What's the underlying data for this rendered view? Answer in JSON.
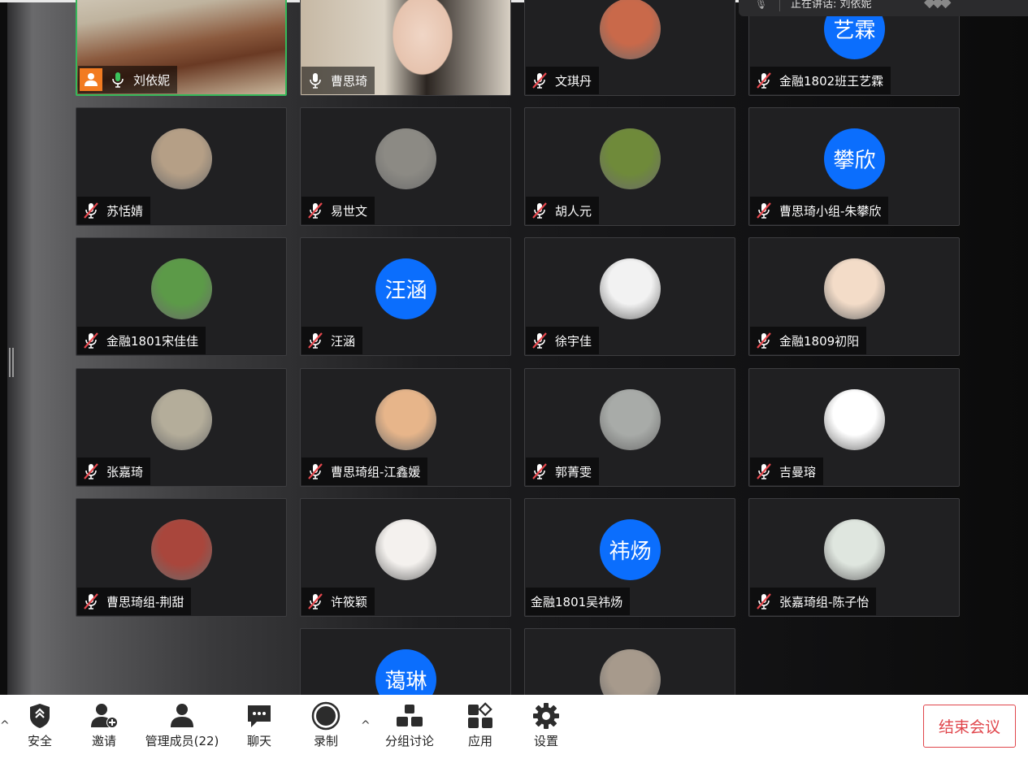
{
  "speaker_popup": {
    "text": "正在讲话: 刘依妮"
  },
  "participants": [
    {
      "name": "刘依妮",
      "mic": "on",
      "host": true,
      "type": "video-room"
    },
    {
      "name": "曹思琦",
      "mic": "on",
      "type": "video-face"
    },
    {
      "name": "文琪丹",
      "mic": "muted",
      "type": "photo",
      "photo_color": "#c9694a"
    },
    {
      "name": "金融1802班王艺霖",
      "mic": "muted",
      "type": "text",
      "avatar_text": "艺霖"
    },
    {
      "name": "苏恬婧",
      "mic": "muted",
      "type": "photo",
      "photo_color": "#b59f86"
    },
    {
      "name": "易世文",
      "mic": "muted",
      "type": "photo",
      "photo_color": "#8c8a84"
    },
    {
      "name": "胡人元",
      "mic": "muted",
      "type": "photo",
      "photo_color": "#6f8a3a"
    },
    {
      "name": "曹思琦小组-朱攀欣",
      "mic": "muted",
      "type": "text",
      "avatar_text": "攀欣"
    },
    {
      "name": "金融1801宋佳佳",
      "mic": "muted",
      "type": "photo",
      "photo_color": "#5c9a48"
    },
    {
      "name": "汪涵",
      "mic": "muted",
      "type": "text",
      "avatar_text": "汪涵"
    },
    {
      "name": "徐宇佳",
      "mic": "muted",
      "type": "photo",
      "photo_color": "#f2f2f2"
    },
    {
      "name": "金融1809初阳",
      "mic": "muted",
      "type": "photo",
      "photo_color": "#f3dcc8"
    },
    {
      "name": "张嘉琦",
      "mic": "muted",
      "type": "photo",
      "photo_color": "#b4ad9a"
    },
    {
      "name": "曹思琦组-江鑫媛",
      "mic": "muted",
      "type": "photo",
      "photo_color": "#e7b58a"
    },
    {
      "name": "郭菁雯",
      "mic": "muted",
      "type": "photo",
      "photo_color": "#a8aba8"
    },
    {
      "name": "吉曼瑢",
      "mic": "muted",
      "type": "photo",
      "photo_color": "#ffffff"
    },
    {
      "name": "曹思琦组-荆甜",
      "mic": "muted",
      "type": "photo",
      "photo_color": "#a9463c"
    },
    {
      "name": "许筱颖",
      "mic": "muted",
      "type": "photo",
      "photo_color": "#f4f1ee"
    },
    {
      "name": "金融1801吴祎炀",
      "mic": "none",
      "type": "text",
      "avatar_text": "祎炀"
    },
    {
      "name": "张嘉琦组-陈子怡",
      "mic": "muted",
      "type": "photo",
      "photo_color": "#dfe6df"
    },
    {
      "name": "",
      "mic": "none",
      "type": "text",
      "avatar_text": "蔼琳"
    },
    {
      "name": "",
      "mic": "none",
      "type": "photo",
      "photo_color": "#a79a8c"
    }
  ],
  "toolbar": {
    "security": "安全",
    "invite": "邀请",
    "manage": "管理成员(22)",
    "chat": "聊天",
    "record": "录制",
    "breakout": "分组讨论",
    "apps": "应用",
    "settings": "设置",
    "end": "结束会议"
  },
  "colors": {
    "accent_blue": "#0b6efd",
    "end_red": "#e0454b",
    "host_orange": "#f27b21",
    "speaking_green": "#35b85a"
  }
}
